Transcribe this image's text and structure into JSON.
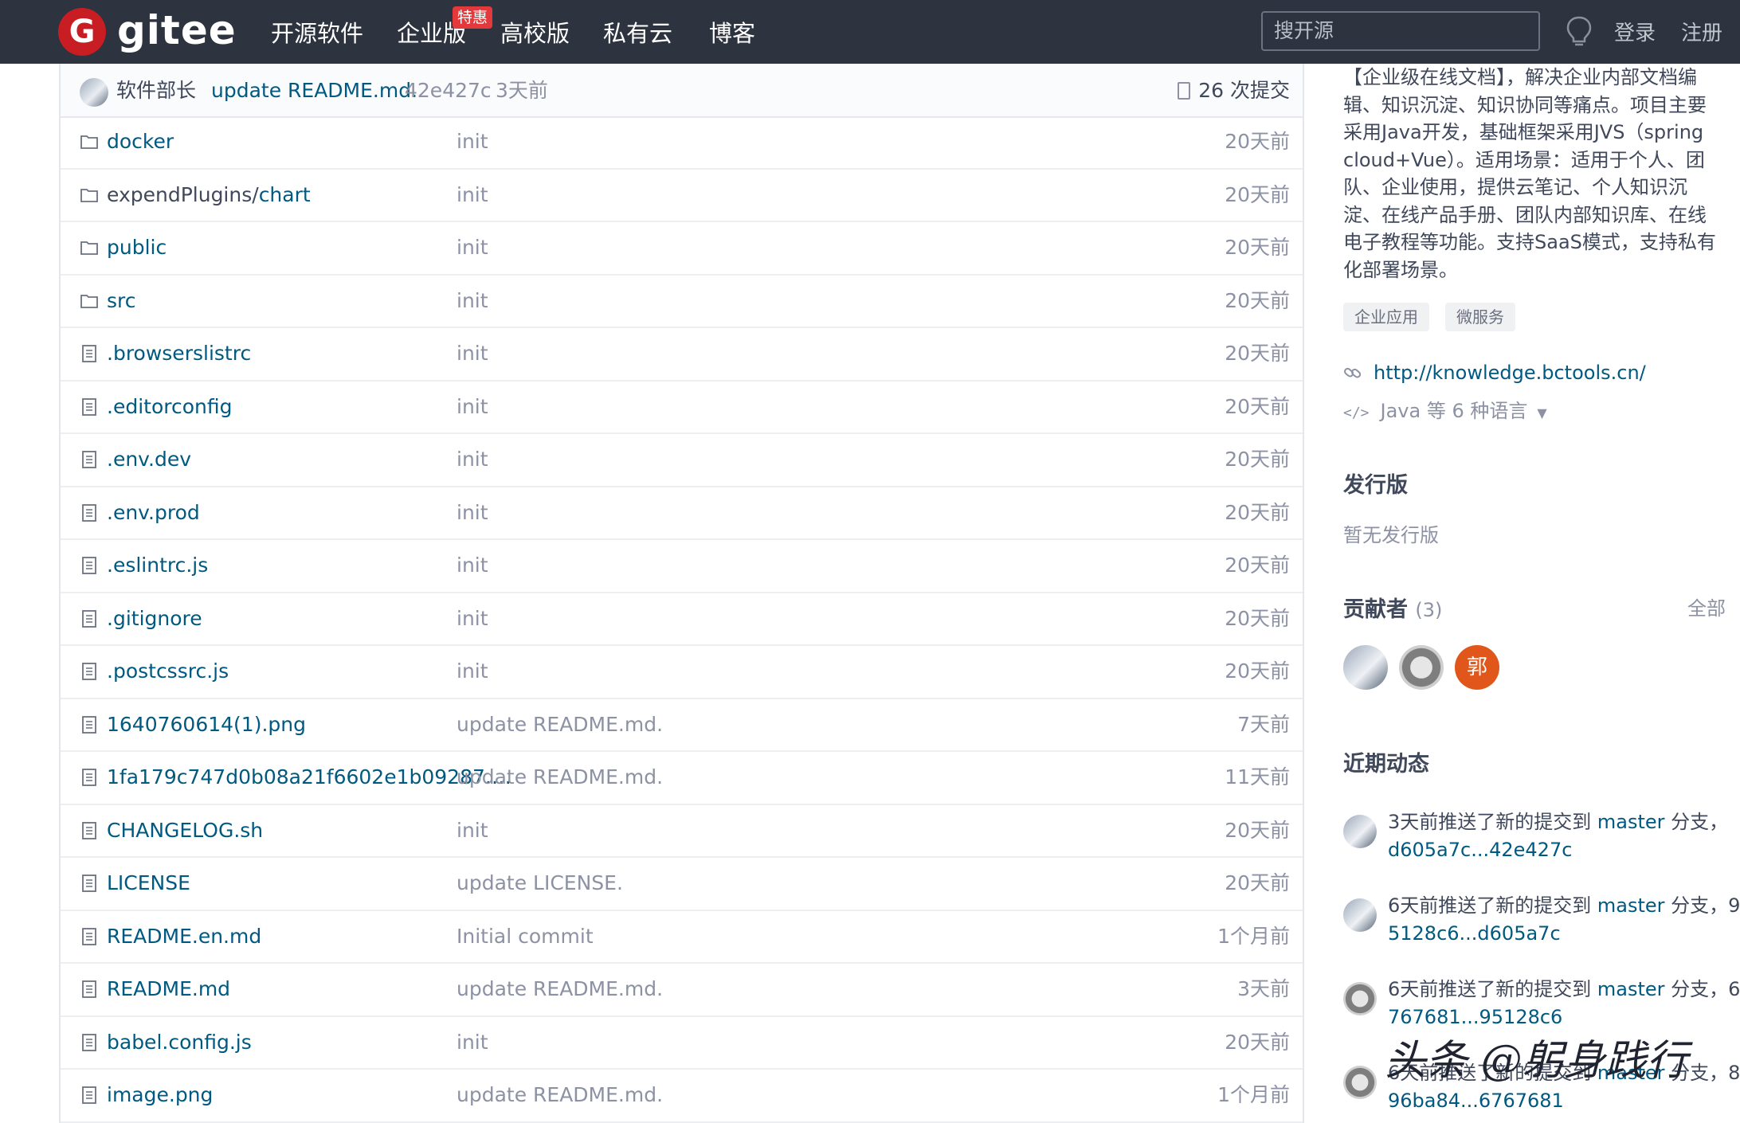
{
  "header": {
    "logo_glyph": "G",
    "logo_text": "gitee",
    "nav": [
      "开源软件",
      "企业版",
      "高校版",
      "私有云",
      "博客"
    ],
    "promo_badge": "特惠",
    "search_placeholder": "搜开源",
    "login": "登录",
    "register": "注册"
  },
  "commit_bar": {
    "author": "软件部长",
    "message": "update README.md.",
    "hash": "42e427c",
    "time": "3天前",
    "count": "26 次提交"
  },
  "files": [
    {
      "type": "folder",
      "name": "docker",
      "message": "init",
      "time": "20天前"
    },
    {
      "type": "folder",
      "name_prefix": "expendPlugins/",
      "name": "chart",
      "message": "init",
      "time": "20天前"
    },
    {
      "type": "folder",
      "name": "public",
      "message": "init",
      "time": "20天前"
    },
    {
      "type": "folder",
      "name": "src",
      "message": "init",
      "time": "20天前"
    },
    {
      "type": "file",
      "name": ".browserslistrc",
      "message": "init",
      "time": "20天前"
    },
    {
      "type": "file",
      "name": ".editorconfig",
      "message": "init",
      "time": "20天前"
    },
    {
      "type": "file",
      "name": ".env.dev",
      "message": "init",
      "time": "20天前"
    },
    {
      "type": "file",
      "name": ".env.prod",
      "message": "init",
      "time": "20天前"
    },
    {
      "type": "file",
      "name": ".eslintrc.js",
      "message": "init",
      "time": "20天前"
    },
    {
      "type": "file",
      "name": ".gitignore",
      "message": "init",
      "time": "20天前"
    },
    {
      "type": "file",
      "name": ".postcssrc.js",
      "message": "init",
      "time": "20天前"
    },
    {
      "type": "file",
      "name": "1640760614(1).png",
      "message": "update README.md.",
      "time": "7天前"
    },
    {
      "type": "file",
      "name": "1fa179c747d0b08a21f6602e1b09287.p...",
      "message": "update README.md.",
      "time": "11天前"
    },
    {
      "type": "file",
      "name": "CHANGELOG.sh",
      "message": "init",
      "time": "20天前"
    },
    {
      "type": "file",
      "name": "LICENSE",
      "message": "update LICENSE.",
      "time": "20天前"
    },
    {
      "type": "file",
      "name": "README.en.md",
      "message": "Initial commit",
      "time": "1个月前"
    },
    {
      "type": "file",
      "name": "README.md",
      "message": "update README.md.",
      "time": "3天前"
    },
    {
      "type": "file",
      "name": "babel.config.js",
      "message": "init",
      "time": "20天前"
    },
    {
      "type": "file",
      "name": "image.png",
      "message": "update README.md.",
      "time": "1个月前"
    }
  ],
  "sidebar": {
    "description_lines": [
      "【企业级在线文档】，解决企业内部文档编",
      "辑、知识沉淀、知识协同等痛点。项目主要",
      "采用Java开发，基础框架采用JVS（spring",
      "cloud+Vue）。适用场景：适用于个人、团",
      "队、企业使用，提供云笔记、个人知识沉",
      "淀、在线产品手册、团队内部知识库、在线",
      "电子教程等功能。支持SaaS模式，支持私有",
      "化部署场景。"
    ],
    "tags": [
      "企业应用",
      "微服务"
    ],
    "homepage": "http://knowledge.bctools.cn/",
    "languages": "Java 等 6 种语言",
    "releases_title": "发行版",
    "releases_empty": "暂无发行版",
    "contributors_title": "贡献者",
    "contributors_count": "(3)",
    "contributors_all": "全部",
    "contributor_initial": "郭",
    "activity_title": "近期动态",
    "activities": [
      {
        "pre": "3天前推送了新的提交到 ",
        "branch": "master",
        "post": " 分支，",
        "range": "d605a7c...42e427c"
      },
      {
        "pre": "6天前推送了新的提交到 ",
        "branch": "master",
        "post": " 分支，9",
        "range": "5128c6...d605a7c"
      },
      {
        "pre": "6天前推送了新的提交到 ",
        "branch": "master",
        "post": " 分支，6",
        "range": "767681...95128c6"
      },
      {
        "pre": "6天前推送了新的提交到 ",
        "branch": "master",
        "post": " 分支，8",
        "range": "96ba84...6767681"
      }
    ]
  },
  "watermark": "头条 @躬身践行",
  "colors": {
    "topbar": "#2d333f",
    "link": "#005980",
    "brand": "#c71d23",
    "promo": "#e4393c",
    "contributor_orange": "#e0561b"
  }
}
